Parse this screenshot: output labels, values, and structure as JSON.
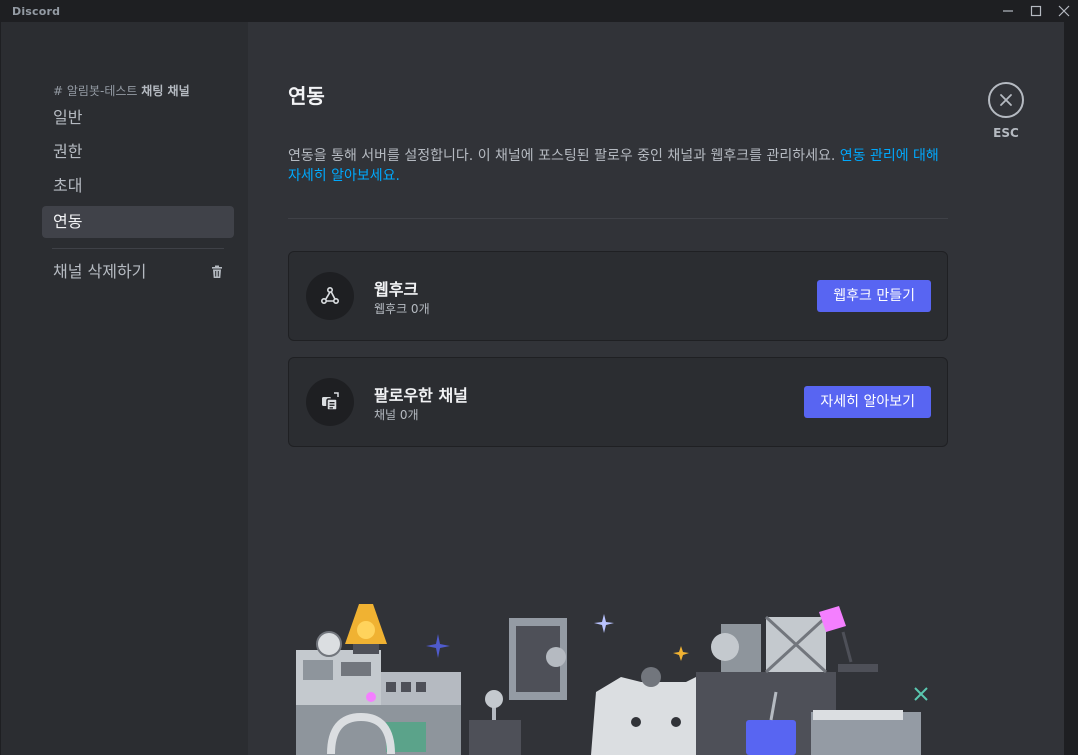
{
  "app": {
    "name": "Discord"
  },
  "sidebar": {
    "channel_prefix": "# 알림봇-테스트",
    "channel_name": "채팅 채널",
    "items": [
      {
        "label": "일반",
        "active": false
      },
      {
        "label": "권한",
        "active": false
      },
      {
        "label": "초대",
        "active": false
      },
      {
        "label": "연동",
        "active": true
      }
    ],
    "delete_label": "채널 삭제하기"
  },
  "main": {
    "title": "연동",
    "description": "연동을 통해 서버를 설정합니다. 이 채널에 포스팅된 팔로우 중인 채널과 웹후크를 관리하세요. ",
    "link": "연동 관리에 대해 자세히 알아보세요.",
    "cards": [
      {
        "title": "웹후크",
        "subtitle": "웹후크 0개",
        "button": "웹후크 만들기",
        "icon": "webhook-icon"
      },
      {
        "title": "팔로우한 채널",
        "subtitle": "채널 0개",
        "button": "자세히 알아보기",
        "icon": "followed-channel-icon"
      }
    ]
  },
  "close": {
    "label": "ESC",
    "icon": "close-icon"
  },
  "colors": {
    "accent": "#5865f2",
    "link": "#00a8fc",
    "bg": "#313338",
    "sidebar": "#2b2d31"
  }
}
